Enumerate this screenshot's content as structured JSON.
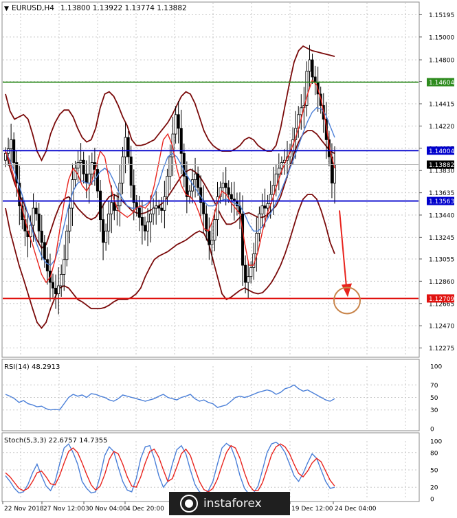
{
  "chart_data": {
    "type": "candlestick",
    "header": {
      "symbol": "EURUSD,H4",
      "ohlc": "1.13800 1.13922 1.13774 1.13882"
    },
    "price_axis": {
      "ylim": [
        1.122,
        1.153
      ],
      "ticks": [
        "1.15195",
        "1.15000",
        "1.14800",
        "1.14610",
        "1.14415",
        "1.14220",
        "1.14025",
        "1.13830",
        "1.13635",
        "1.13440",
        "1.13245",
        "1.13055",
        "1.12860",
        "1.12665",
        "1.12470",
        "1.12275"
      ]
    },
    "time_axis": {
      "labels": [
        "22 Nov 2018",
        "27 Nov 12:00",
        "30 Nov 04:00",
        "4 Dec 20:00",
        "19 Dec 12:00",
        "24 Dec 04:00"
      ]
    },
    "levels": [
      {
        "name": "resistance-green",
        "value": 1.14604,
        "label": "1.14604",
        "color": "#2e8b1e"
      },
      {
        "name": "level-blue-upper",
        "value": 1.14004,
        "label": "1.14004",
        "color": "#0000cc"
      },
      {
        "name": "current-price",
        "value": 1.13882,
        "label": "1.13882",
        "color": "#000000"
      },
      {
        "name": "level-blue-lower",
        "value": 1.13563,
        "label": "1.13563",
        "color": "#0000cc"
      },
      {
        "name": "target-red",
        "value": 1.12709,
        "label": "1.12709",
        "color": "#e0120f"
      }
    ],
    "candles_close": [
      1.1398,
      1.1402,
      1.141,
      1.139,
      1.1372,
      1.1352,
      1.134,
      1.133,
      1.1325,
      1.1335,
      1.135,
      1.1345,
      1.133,
      1.132,
      1.1305,
      1.1295,
      1.1285,
      1.128,
      1.1275,
      1.1282,
      1.1292,
      1.1305,
      1.133,
      1.135,
      1.1375,
      1.1385,
      1.139,
      1.1392,
      1.138,
      1.1372,
      1.138,
      1.139,
      1.1384,
      1.1365,
      1.134,
      1.132,
      1.133,
      1.1345,
      1.1355,
      1.1348,
      1.1352,
      1.1372,
      1.1395,
      1.1412,
      1.1395,
      1.137,
      1.1355,
      1.135,
      1.1342,
      1.1335,
      1.133,
      1.1338,
      1.1345,
      1.135,
      1.1352,
      1.135,
      1.1348,
      1.136,
      1.1378,
      1.1395,
      1.1415,
      1.1432,
      1.142,
      1.1398,
      1.1378,
      1.136,
      1.1365,
      1.1375,
      1.138,
      1.1368,
      1.1355,
      1.1345,
      1.133,
      1.1318,
      1.1322,
      1.134,
      1.136,
      1.1368,
      1.1372,
      1.1368,
      1.1362,
      1.1358,
      1.1356,
      1.1352,
      1.1345,
      1.13,
      1.1285,
      1.129,
      1.1298,
      1.131,
      1.1328,
      1.1345,
      1.1352,
      1.135,
      1.1354,
      1.1362,
      1.137,
      1.138,
      1.1385,
      1.139,
      1.1392,
      1.1395,
      1.14,
      1.141,
      1.142,
      1.1432,
      1.1438,
      1.144,
      1.147,
      1.148,
      1.1465,
      1.146,
      1.145,
      1.144,
      1.1428,
      1.141,
      1.1395,
      1.1372,
      1.1388
    ],
    "ma_fast_red": [
      1.14,
      1.139,
      1.1375,
      1.136,
      1.1345,
      1.133,
      1.1318,
      1.1305,
      1.1292,
      1.1285,
      1.129,
      1.1305,
      1.133,
      1.1355,
      1.1375,
      1.1385,
      1.138,
      1.137,
      1.1365,
      1.1372,
      1.1385,
      1.14,
      1.1395,
      1.1375,
      1.1358,
      1.1348,
      1.1345,
      1.1342,
      1.1345,
      1.135,
      1.1352,
      1.135,
      1.1355,
      1.137,
      1.139,
      1.141,
      1.1415,
      1.1405,
      1.1385,
      1.137,
      1.1362,
      1.136,
      1.1355,
      1.1345,
      1.1332,
      1.133,
      1.134,
      1.1355,
      1.1365,
      1.1362,
      1.1355,
      1.135,
      1.1345,
      1.132,
      1.13,
      1.13,
      1.1312,
      1.133,
      1.1345,
      1.1355,
      1.1368,
      1.138,
      1.139,
      1.1398,
      1.1408,
      1.142,
      1.1435,
      1.145,
      1.1462,
      1.1458,
      1.1445,
      1.1425,
      1.14,
      1.1385
    ],
    "ma_mid_blue": [
      1.14,
      1.1392,
      1.1382,
      1.137,
      1.1358,
      1.1345,
      1.133,
      1.1318,
      1.1308,
      1.1302,
      1.13,
      1.1305,
      1.1318,
      1.1335,
      1.1352,
      1.1365,
      1.1372,
      1.1374,
      1.1372,
      1.1372,
      1.1376,
      1.1382,
      1.1385,
      1.1382,
      1.1374,
      1.1365,
      1.1358,
      1.1352,
      1.135,
      1.135,
      1.1351,
      1.1353,
      1.1356,
      1.1362,
      1.1372,
      1.1385,
      1.1395,
      1.1398,
      1.1395,
      1.1388,
      1.138,
      1.1374,
      1.1368,
      1.1362,
      1.1356,
      1.1352,
      1.1352,
      1.1354,
      1.1357,
      1.1358,
      1.1356,
      1.1354,
      1.1352,
      1.1345,
      1.1336,
      1.133,
      1.133,
      1.1334,
      1.134,
      1.1347,
      1.1355,
      1.1364,
      1.1374,
      1.1384,
      1.1394,
      1.1405,
      1.1416,
      1.1426,
      1.1434,
      1.1438,
      1.1437,
      1.1432,
      1.1422,
      1.1412
    ],
    "bb_upper": [
      1.145,
      1.1435,
      1.1428,
      1.143,
      1.1432,
      1.1428,
      1.1415,
      1.14,
      1.1392,
      1.14,
      1.1415,
      1.1425,
      1.1432,
      1.1436,
      1.1436,
      1.143,
      1.142,
      1.1412,
      1.1408,
      1.141,
      1.142,
      1.1438,
      1.145,
      1.1452,
      1.1448,
      1.144,
      1.143,
      1.1422,
      1.141,
      1.1405,
      1.1405,
      1.1406,
      1.1408,
      1.141,
      1.1415,
      1.142,
      1.1425,
      1.1432,
      1.144,
      1.1448,
      1.1452,
      1.145,
      1.1442,
      1.143,
      1.1418,
      1.141,
      1.1405,
      1.1402,
      1.14,
      1.14,
      1.14,
      1.1402,
      1.1405,
      1.141,
      1.1412,
      1.141,
      1.1405,
      1.1402,
      1.14,
      1.14,
      1.1405,
      1.142,
      1.144,
      1.146,
      1.1478,
      1.1488,
      1.1492,
      1.149,
      1.1488,
      1.1487,
      1.1486,
      1.1485,
      1.1484,
      1.1483
    ],
    "bb_lower": [
      1.135,
      1.133,
      1.1315,
      1.13,
      1.1288,
      1.1275,
      1.1262,
      1.125,
      1.1245,
      1.125,
      1.1262,
      1.1272,
      1.128,
      1.1282,
      1.128,
      1.1275,
      1.127,
      1.1268,
      1.1265,
      1.1262,
      1.1262,
      1.1262,
      1.1263,
      1.1265,
      1.1268,
      1.127,
      1.127,
      1.127,
      1.1272,
      1.1275,
      1.128,
      1.129,
      1.1298,
      1.1305,
      1.1308,
      1.131,
      1.1312,
      1.1315,
      1.1318,
      1.132,
      1.1322,
      1.1325,
      1.1328,
      1.133,
      1.1328,
      1.132,
      1.1305,
      1.129,
      1.1275,
      1.127,
      1.1272,
      1.1275,
      1.1278,
      1.128,
      1.1278,
      1.1276,
      1.1275,
      1.1276,
      1.128,
      1.1285,
      1.1292,
      1.13,
      1.131,
      1.1322,
      1.1335,
      1.1348,
      1.1358,
      1.1362,
      1.1362,
      1.1358,
      1.1348,
      1.1335,
      1.132,
      1.131
    ],
    "bb_mid": [
      1.14,
      1.1385,
      1.1372,
      1.1362,
      1.1355,
      1.1345,
      1.1332,
      1.1322,
      1.1315,
      1.1318,
      1.133,
      1.1342,
      1.1352,
      1.1358,
      1.136,
      1.1356,
      1.135,
      1.1346,
      1.1342,
      1.134,
      1.1342,
      1.1348,
      1.1355,
      1.136,
      1.1362,
      1.136,
      1.1356,
      1.1352,
      1.1348,
      1.1346,
      1.1345,
      1.1346,
      1.1348,
      1.135,
      1.1352,
      1.1355,
      1.136,
      1.1366,
      1.1372,
      1.1378,
      1.1382,
      1.1384,
      1.1382,
      1.1378,
      1.1372,
      1.1365,
      1.1358,
      1.135,
      1.1342,
      1.1336,
      1.1336,
      1.1338,
      1.1342,
      1.1345,
      1.1346,
      1.1344,
      1.1342,
      1.1342,
      1.1344,
      1.1348,
      1.1352,
      1.136,
      1.1372,
      1.1385,
      1.1398,
      1.1408,
      1.1415,
      1.1418,
      1.1418,
      1.1415,
      1.141,
      1.1405,
      1.14,
      1.1398
    ],
    "forecast_arrow": {
      "from_price": 1.1348,
      "to_price": 1.12709
    },
    "rsi": {
      "label": "RSI(14) 48.2913",
      "ylim": [
        0,
        100
      ],
      "ticks": [
        "100",
        "70",
        "50",
        "30",
        "0"
      ],
      "values": [
        55,
        52,
        48,
        42,
        45,
        40,
        38,
        35,
        36,
        32,
        30,
        31,
        30,
        40,
        50,
        55,
        52,
        54,
        50,
        56,
        55,
        52,
        50,
        46,
        44,
        48,
        54,
        52,
        50,
        48,
        46,
        44,
        46,
        48,
        52,
        55,
        50,
        48,
        46,
        50,
        52,
        55,
        48,
        44,
        46,
        42,
        40,
        34,
        36,
        38,
        44,
        50,
        52,
        50,
        52,
        55,
        58,
        60,
        62,
        60,
        55,
        58,
        64,
        66,
        70,
        64,
        60,
        62,
        58,
        54,
        50,
        46,
        44,
        48
      ]
    },
    "stoch": {
      "label": "Stoch(5,3,3) 22.6757 14.7355",
      "ylim": [
        0,
        100
      ],
      "ticks": [
        "100",
        "80",
        "50",
        "20",
        "0"
      ],
      "k": [
        40,
        30,
        18,
        10,
        12,
        25,
        45,
        60,
        40,
        22,
        14,
        30,
        60,
        88,
        95,
        80,
        60,
        30,
        18,
        10,
        12,
        40,
        75,
        90,
        82,
        55,
        30,
        15,
        12,
        35,
        70,
        90,
        92,
        70,
        40,
        20,
        30,
        60,
        85,
        92,
        78,
        50,
        25,
        12,
        8,
        14,
        30,
        60,
        88,
        96,
        90,
        70,
        40,
        18,
        8,
        10,
        22,
        50,
        80,
        95,
        98,
        92,
        80,
        60,
        40,
        30,
        44,
        62,
        78,
        70,
        50,
        30,
        18,
        20
      ],
      "d": [
        45,
        38,
        28,
        18,
        14,
        18,
        30,
        45,
        48,
        38,
        26,
        24,
        40,
        62,
        82,
        88,
        80,
        62,
        42,
        24,
        15,
        22,
        42,
        68,
        82,
        78,
        60,
        38,
        22,
        20,
        38,
        62,
        82,
        86,
        72,
        50,
        30,
        35,
        55,
        78,
        86,
        75,
        52,
        30,
        16,
        12,
        18,
        34,
        58,
        80,
        92,
        88,
        70,
        45,
        24,
        14,
        14,
        28,
        52,
        76,
        90,
        95,
        90,
        78,
        60,
        44,
        38,
        48,
        62,
        70,
        64,
        48,
        32,
        22
      ]
    }
  }
}
